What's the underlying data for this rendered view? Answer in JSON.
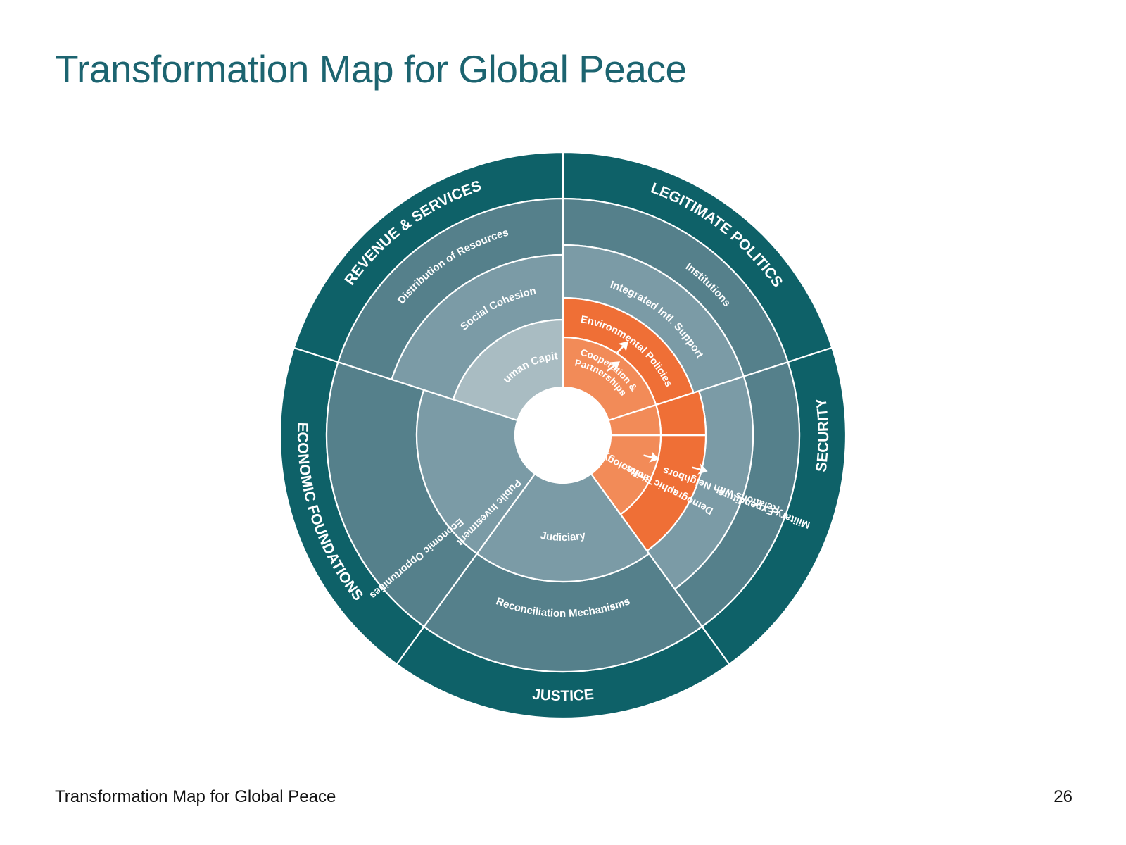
{
  "title": "Transformation Map for Global Peace",
  "footer": {
    "title": "Transformation Map for Global Peace",
    "page_number": "26"
  },
  "colors": {
    "title": "#1c6470",
    "outer_ring": "#0e6168",
    "ring_mid": "#55808b",
    "ring_light": "#7b9ba6",
    "ring_pale": "#a9bcc2",
    "highlight_dark": "#ef6f36",
    "highlight_light": "#f28b58",
    "divider": "#ffffff"
  },
  "diagram": {
    "outer_categories": [
      {
        "id": "legitimate-politics",
        "label": "LEGITIMATE POLITICS"
      },
      {
        "id": "security",
        "label": "SECURITY"
      },
      {
        "id": "justice",
        "label": "JUSTICE"
      },
      {
        "id": "economic-foundations",
        "label": "ECONOMIC FOUNDATIONS"
      },
      {
        "id": "revenue-services",
        "label": "REVENUE & SERVICES"
      }
    ],
    "segments": [
      {
        "id": "institutions",
        "label": "Institutions",
        "color": "ring_mid"
      },
      {
        "id": "integrated-intl-support",
        "label": "Integrated Intl. Support",
        "color": "ring_light"
      },
      {
        "id": "environmental-policies",
        "label": "Environmental Policies",
        "color": "highlight_dark"
      },
      {
        "id": "cooperation-partnerships",
        "label": "Cooperation &",
        "label2": "Partnerships",
        "color": "highlight_light"
      },
      {
        "id": "military-expenditure",
        "label": "Military Expenditure",
        "color": "ring_mid"
      },
      {
        "id": "relations-with-neighbors",
        "label": "Relations with Neighbors",
        "color": "ring_light"
      },
      {
        "id": "demographic-shifts",
        "label": "Demographic Shifts",
        "color": "highlight_dark"
      },
      {
        "id": "technology",
        "label": "Technology",
        "color": "highlight_light"
      },
      {
        "id": "reconciliation-mechanisms",
        "label": "Reconciliation Mechanisms",
        "color": "ring_mid"
      },
      {
        "id": "judiciary",
        "label": "Judiciary",
        "color": "ring_light"
      },
      {
        "id": "economic-opportunities",
        "label": "Economic Opportunities",
        "color": "ring_mid"
      },
      {
        "id": "public-investment",
        "label": "Public Investment",
        "color": "ring_light"
      },
      {
        "id": "distribution-of-resources",
        "label": "Distribution of Resources",
        "color": "ring_mid"
      },
      {
        "id": "social-cohesion",
        "label": "Social Cohesion",
        "color": "ring_light"
      },
      {
        "id": "human-capital",
        "label": "Human Capital",
        "color": "ring_pale"
      }
    ]
  }
}
